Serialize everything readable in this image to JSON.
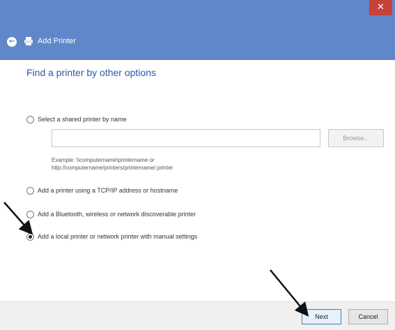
{
  "window": {
    "title": "Add Printer",
    "close_glyph": "✕"
  },
  "header": {
    "back_glyph": "←",
    "title": "Add Printer"
  },
  "main": {
    "heading": "Find a printer by other options",
    "options": [
      {
        "label": "Select a shared printer by name",
        "checked": false
      },
      {
        "label": "Add a printer using a TCP/IP address or hostname",
        "checked": false
      },
      {
        "label": "Add a Bluetooth, wireless or network discoverable printer",
        "checked": false
      },
      {
        "label": "Add a local printer or network printer with manual settings",
        "checked": true
      }
    ],
    "shared_name_input": {
      "value": "",
      "placeholder": ""
    },
    "browse_label": "Browse...",
    "example_line1": "Example: \\\\computername\\printername or",
    "example_line2": "http://computername/printers/printername/.printer"
  },
  "footer": {
    "next_label": "Next",
    "cancel_label": "Cancel"
  },
  "colors": {
    "titlebar": "#5f87c9",
    "close": "#c7423b",
    "heading": "#2a5aa6"
  },
  "icons": [
    "back-arrow-icon",
    "printer-icon",
    "close-icon"
  ]
}
